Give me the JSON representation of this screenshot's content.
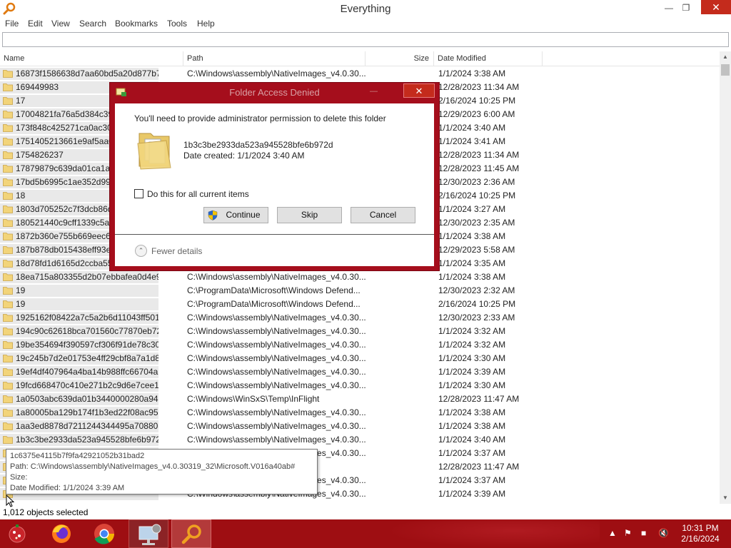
{
  "window": {
    "title": "Everything"
  },
  "menu": [
    "File",
    "Edit",
    "View",
    "Search",
    "Bookmarks",
    "Tools",
    "Help"
  ],
  "search": {
    "value": ""
  },
  "columns": {
    "name": "Name",
    "path": "Path",
    "size": "Size",
    "date": "Date Modified"
  },
  "rows": [
    {
      "name": "16873f1586638d7aa60bd5a20d877b7e",
      "path": "C:\\Windows\\assembly\\NativeImages_v4.0.30...",
      "date": "1/1/2024 3:38 AM"
    },
    {
      "name": "169449983",
      "path": "",
      "date": "12/28/2023 11:34 AM"
    },
    {
      "name": "17",
      "path": "",
      "date": "2/16/2024 10:25 PM"
    },
    {
      "name": "17004821fa76a5d384c39c",
      "path": "",
      "date": "12/29/2023 6:00 AM"
    },
    {
      "name": "173f848c425271ca0ac307",
      "path": "",
      "date": "1/1/2024 3:40 AM"
    },
    {
      "name": "1751405213661e9af5aa0e",
      "path": "",
      "date": "1/1/2024 3:41 AM"
    },
    {
      "name": "1754826237",
      "path": "",
      "date": "12/28/2023 11:34 AM"
    },
    {
      "name": "17879879c639da01ca1a00",
      "path": "",
      "date": "12/28/2023 11:45 AM"
    },
    {
      "name": "17bd5b6995c1ae352d990",
      "path": "",
      "date": "12/30/2023 2:36 AM"
    },
    {
      "name": "18",
      "path": "",
      "date": "2/16/2024 10:25 PM"
    },
    {
      "name": "1803d705252c7f3dcb86d3",
      "path": "",
      "date": "1/1/2024 3:27 AM"
    },
    {
      "name": "180521440c9cff1339c5a9",
      "path": "",
      "date": "12/30/2023 2:35 AM"
    },
    {
      "name": "1872b360e755b669eec60b",
      "path": "",
      "date": "1/1/2024 3:38 AM"
    },
    {
      "name": "187b878db015438eff93e3",
      "path": "",
      "date": "12/29/2023 5:58 AM"
    },
    {
      "name": "18d78fd1d6165d2ccba55",
      "path": "",
      "date": "1/1/2024 3:35 AM"
    },
    {
      "name": "18ea715a803355d2b07ebbafea0d4e9a",
      "path": "C:\\Windows\\assembly\\NativeImages_v4.0.30...",
      "date": "1/1/2024 3:38 AM"
    },
    {
      "name": "19",
      "path": "C:\\ProgramData\\Microsoft\\Windows Defend...",
      "date": "12/30/2023 2:32 AM"
    },
    {
      "name": "19",
      "path": "C:\\ProgramData\\Microsoft\\Windows Defend...",
      "date": "2/16/2024 10:25 PM"
    },
    {
      "name": "1925162f08422a7c5a2b6d11043ff501",
      "path": "C:\\Windows\\assembly\\NativeImages_v4.0.30...",
      "date": "12/30/2023 2:33 AM"
    },
    {
      "name": "194c90c62618bca701560c77870eb725",
      "path": "C:\\Windows\\assembly\\NativeImages_v4.0.30...",
      "date": "1/1/2024 3:32 AM"
    },
    {
      "name": "19be354694f390597cf306f91de78c30",
      "path": "C:\\Windows\\assembly\\NativeImages_v4.0.30...",
      "date": "1/1/2024 3:32 AM"
    },
    {
      "name": "19c245b7d2e01753e4ff29cbf8a7a1d8",
      "path": "C:\\Windows\\assembly\\NativeImages_v4.0.30...",
      "date": "1/1/2024 3:30 AM"
    },
    {
      "name": "19ef4df407964a4ba14b988ffc66704a",
      "path": "C:\\Windows\\assembly\\NativeImages_v4.0.30...",
      "date": "1/1/2024 3:39 AM"
    },
    {
      "name": "19fcd668470c410e271b2c9d6e7cee13",
      "path": "C:\\Windows\\assembly\\NativeImages_v4.0.30...",
      "date": "1/1/2024 3:30 AM"
    },
    {
      "name": "1a0503abc639da01b3440000280a9409",
      "path": "C:\\Windows\\WinSxS\\Temp\\InFlight",
      "date": "12/28/2023 11:47 AM"
    },
    {
      "name": "1a80005ba129b174f1b3ed22f08ac95d",
      "path": "C:\\Windows\\assembly\\NativeImages_v4.0.30...",
      "date": "1/1/2024 3:38 AM"
    },
    {
      "name": "1aa3ed8878d7211244344495a7088085",
      "path": "C:\\Windows\\assembly\\NativeImages_v4.0.30...",
      "date": "1/1/2024 3:38 AM"
    },
    {
      "name": "1b3c3be2933da523a945528bfe6b972d",
      "path": "C:\\Windows\\assembly\\NativeImages_v4.0.30...",
      "date": "1/1/2024 3:40 AM"
    },
    {
      "name": "",
      "path": "C:\\Windows\\assembly\\NativeImages_v4.0.30...",
      "date": "1/1/2024 3:37 AM"
    },
    {
      "name": "",
      "path": "",
      "date": "12/28/2023 11:47 AM"
    },
    {
      "name": "",
      "path": "C:\\Windows\\assembly\\NativeImages_v4.0.30...",
      "date": "1/1/2024 3:37 AM"
    },
    {
      "name": "",
      "path": "C:\\Windows\\assembly\\NativeImages_v4.0.30...",
      "date": "1/1/2024 3:39 AM"
    }
  ],
  "tooltip": {
    "name": "1c6375e4115b7f9fa42921052b31bad2",
    "path": "Path: C:\\Windows\\assembly\\NativeImages_v4.0.30319_32\\Microsoft.V016a40ab#",
    "size": "Size:",
    "date": "Date Modified: 1/1/2024 3:39 AM"
  },
  "status": {
    "text": "1,012 objects selected"
  },
  "dialog": {
    "title": "Folder Access Denied",
    "message": "You'll need to provide administrator permission to delete this folder",
    "folder_name": "1b3c3be2933da523a945528bfe6b972d",
    "date_created": "Date created: 1/1/2024 3:40 AM",
    "checkbox_label": "Do this for all current items",
    "continue": "Continue",
    "skip": "Skip",
    "cancel": "Cancel",
    "details": "Fewer details"
  },
  "taskbar": {
    "apps": [
      "start-icon",
      "firefox-icon",
      "chrome-icon",
      "network-settings-icon",
      "everything-icon"
    ],
    "time": "10:31 PM",
    "date": "2/16/2024"
  },
  "colors": {
    "accent": "#a50e1c",
    "taskbar": "#9e0e12",
    "close": "#c42b1c"
  }
}
